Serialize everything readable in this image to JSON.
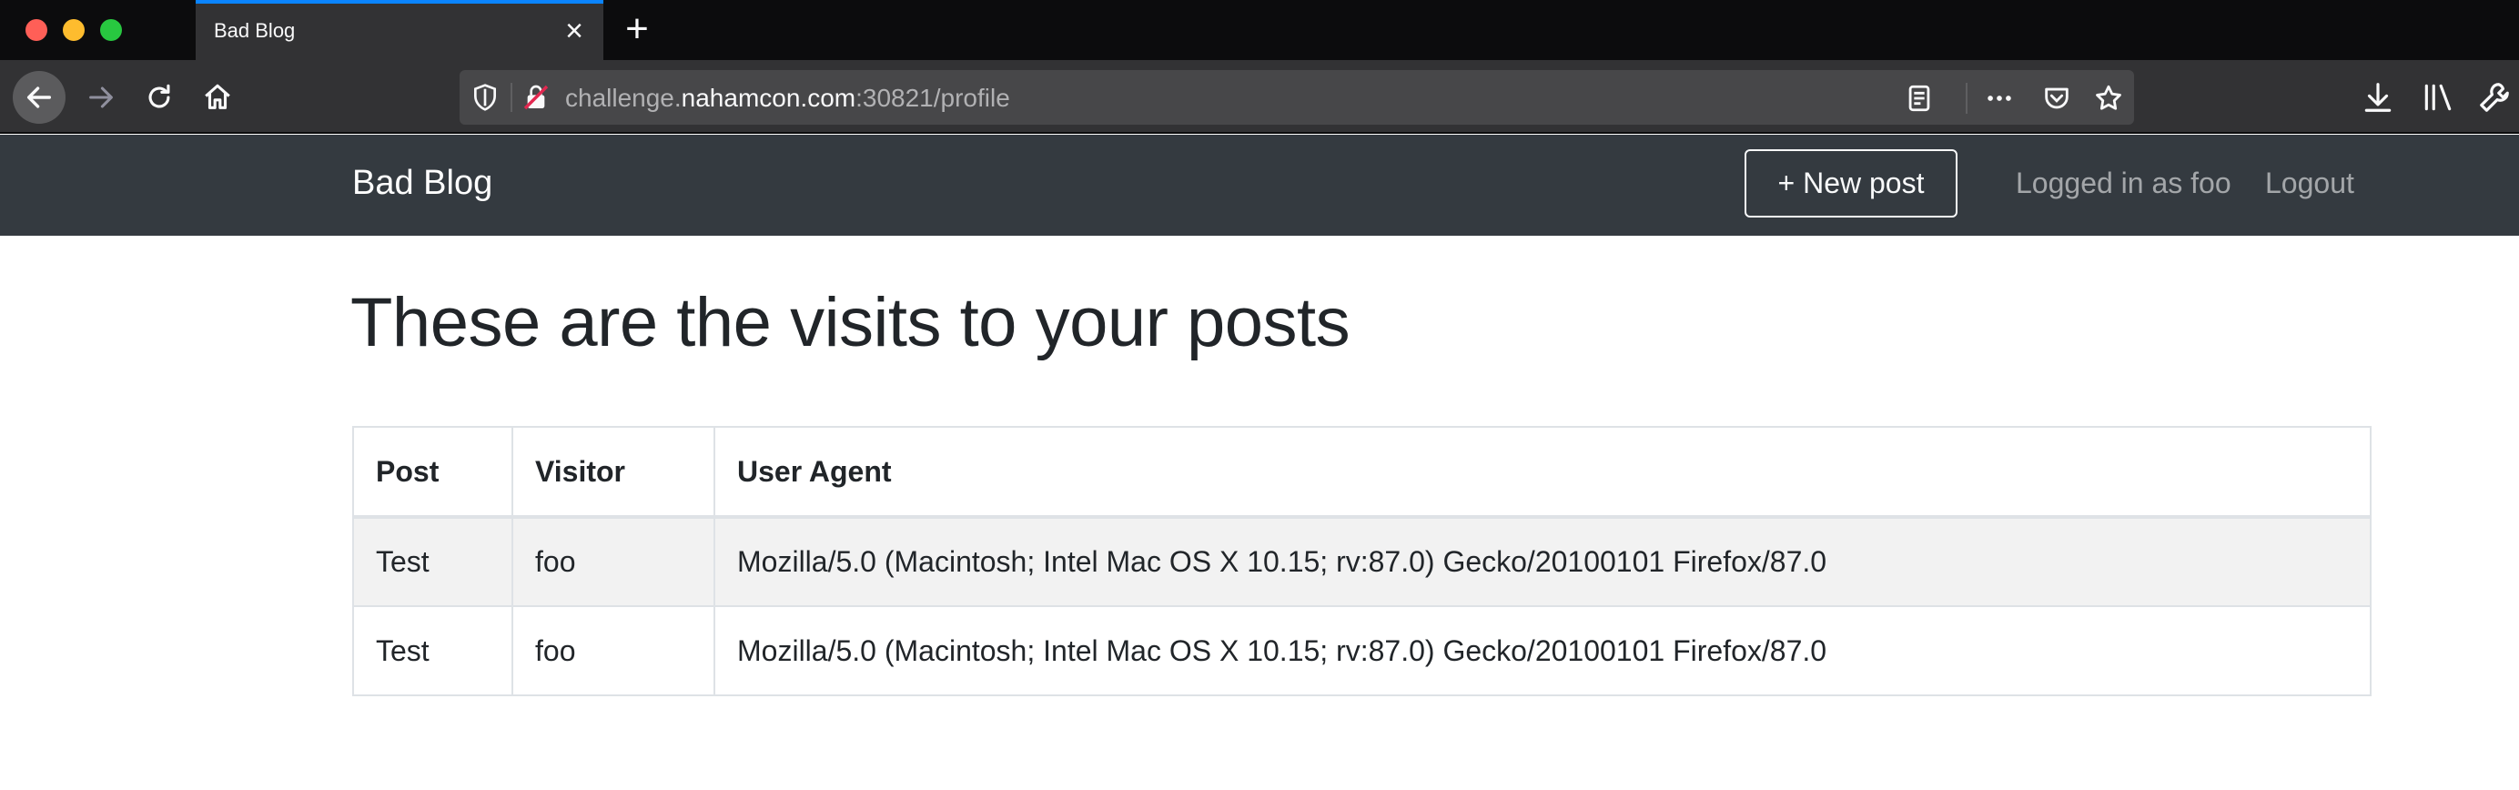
{
  "browser": {
    "tab_title": "Bad Blog",
    "url": {
      "prefix": "challenge.",
      "host": "nahamcon.com",
      "suffix": ":30821/profile"
    }
  },
  "site": {
    "brand": "Bad Blog",
    "new_post_label": "+ New post",
    "logged_in_label": "Logged in as foo",
    "logout_label": "Logout"
  },
  "main": {
    "heading": "These are the visits to your posts",
    "table": {
      "headers": [
        "Post",
        "Visitor",
        "User Agent"
      ],
      "rows": [
        [
          "Test",
          "foo",
          "Mozilla/5.0 (Macintosh; Intel Mac OS X 10.15; rv:87.0) Gecko/20100101 Firefox/87.0"
        ],
        [
          "Test",
          "foo",
          "Mozilla/5.0 (Macintosh; Intel Mac OS X 10.15; rv:87.0) Gecko/20100101 Firefox/87.0"
        ]
      ]
    }
  },
  "colors": {
    "site_navbar": "#343a40",
    "tab_accent": "#0a84ff",
    "row_stripe": "#f2f2f2"
  },
  "icons": [
    "back-arrow-icon",
    "forward-arrow-icon",
    "reload-icon",
    "home-icon",
    "shield-icon",
    "insecure-lock-icon",
    "reader-view-icon",
    "more-icon",
    "pocket-icon",
    "bookmark-star-icon",
    "download-icon",
    "library-icon",
    "wrench-icon",
    "close-icon",
    "plus-icon"
  ]
}
